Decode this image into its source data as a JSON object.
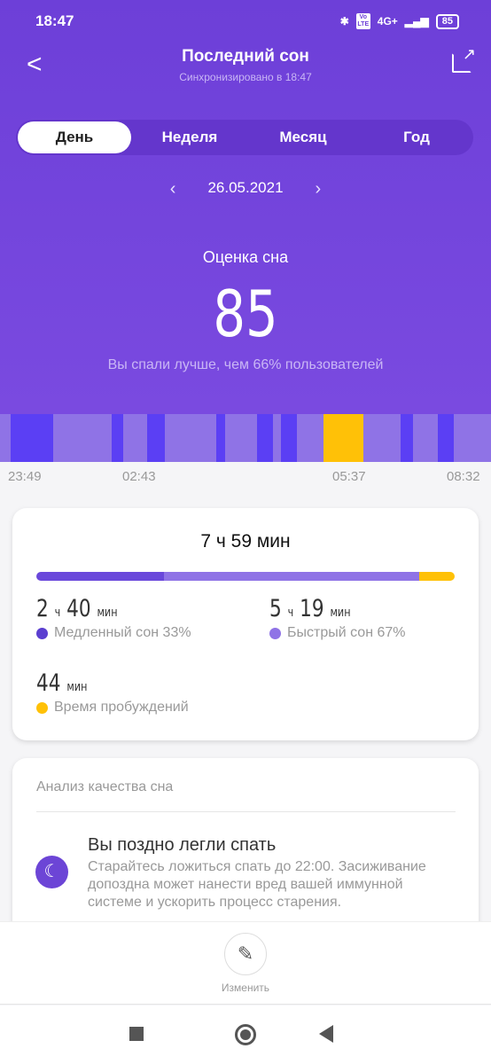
{
  "status": {
    "time": "18:47",
    "battery": "85",
    "network": "4G+",
    "volte": "Vo LTE"
  },
  "header": {
    "title": "Последний сон",
    "subtitle": "Синхронизировано в 18:47"
  },
  "tabs": [
    {
      "label": "День",
      "active": true
    },
    {
      "label": "Неделя"
    },
    {
      "label": "Месяц"
    },
    {
      "label": "Год"
    }
  ],
  "date": "26.05.2021",
  "score": {
    "label": "Оценка сна",
    "value": "85",
    "comparison": "Вы спали лучше, чем 66% пользователей"
  },
  "colors": {
    "deep": "#5b3ff4",
    "light": "#8f73e6",
    "awake": "#ffc107",
    "accent": "#6c45d6"
  },
  "hypnogram": {
    "times": [
      "23:49",
      "02:43",
      "05:37",
      "08:32"
    ],
    "segments_min": [
      [
        "light",
        11
      ],
      [
        "deep",
        46
      ],
      [
        "light",
        62
      ],
      [
        "deep",
        12
      ],
      [
        "light",
        25
      ],
      [
        "deep",
        19
      ],
      [
        "light",
        55
      ],
      [
        "deep",
        9
      ],
      [
        "light",
        34
      ],
      [
        "deep",
        17
      ],
      [
        "light",
        9
      ],
      [
        "deep",
        17
      ],
      [
        "light",
        28
      ],
      [
        "awake",
        42
      ],
      [
        "light",
        40
      ],
      [
        "deep",
        13
      ],
      [
        "light",
        26
      ],
      [
        "deep",
        17
      ],
      [
        "light",
        40
      ]
    ]
  },
  "summary": {
    "total": "7 ч 59 мин",
    "deep": {
      "h": "2",
      "m": "40",
      "label": "Медленный сон 33%",
      "pct": 33
    },
    "light": {
      "h": "5",
      "m": "19",
      "label": "Быстрый сон 67%",
      "pct": 67
    },
    "awake": {
      "m": "44",
      "label": "Время пробуждений",
      "min": 44
    },
    "u_h": "ч",
    "u_m": "мин"
  },
  "analysis": {
    "title": "Анализ качества сна",
    "item_title": "Вы поздно легли спать",
    "item_text": "Старайтесь ложиться спать до 22:00. Засиживание допоздна может нанести вред вашей иммунной системе и ускорить процесс старения."
  },
  "edit_label": "Изменить"
}
